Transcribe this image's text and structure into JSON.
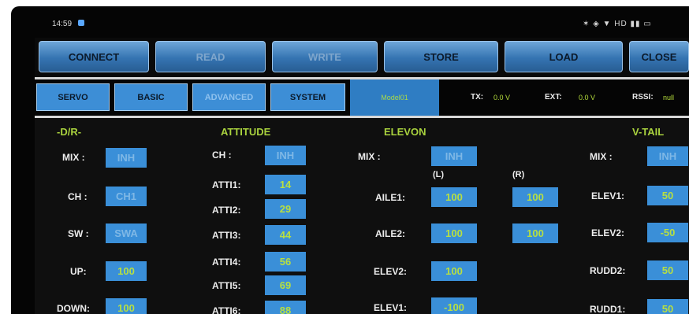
{
  "status": {
    "time": "14:59",
    "icons_right": "✶ ◈ ▼ HD ▮▮ ▭"
  },
  "toolbar": {
    "connect": "CONNECT",
    "read": "READ",
    "write": "WRITE",
    "store": "STORE",
    "load": "LOAD",
    "close": "CLOSE"
  },
  "tabs": {
    "servo": "SERVO",
    "basic": "BASIC",
    "advanced": "ADVANCED",
    "system": "SYSTEM",
    "model": "Model01"
  },
  "telemetry": {
    "tx_label": "TX:",
    "tx_value": "0.0 V",
    "ext_label": "EXT:",
    "ext_value": "0.0 V",
    "rssi_label": "RSSI:",
    "rssi_value": "null"
  },
  "dr": {
    "title": "-D/R-",
    "mix_label": "MIX :",
    "mix_value": "INH",
    "ch_label": "CH :",
    "ch_value": "CH1",
    "sw_label": "SW :",
    "sw_value": "SWA",
    "up_label": "UP:",
    "up_value": "100",
    "down_label": "DOWN:",
    "down_value": "100"
  },
  "attitude": {
    "title": "ATTITUDE",
    "ch_label": "CH :",
    "ch_value": "INH",
    "att1_label": "ATTI1:",
    "att1_value": "14",
    "att2_label": "ATTI2:",
    "att2_value": "29",
    "att3_label": "ATTI3:",
    "att3_value": "44",
    "att4_label": "ATTI4:",
    "att4_value": "56",
    "att5_label": "ATTI5:",
    "att5_value": "69",
    "att6_label": "ATTI6:",
    "att6_value": "88"
  },
  "elevon": {
    "title": "ELEVON",
    "mix_label": "MIX :",
    "mix_value": "INH",
    "l_label": "(L)",
    "r_label": "(R)",
    "aile1_label": "AILE1:",
    "aile1_l": "100",
    "aile1_r": "100",
    "aile2_label": "AILE2:",
    "aile2_l": "100",
    "aile2_r": "100",
    "elev2_label": "ELEV2:",
    "elev2_value": "100",
    "elev1_label": "ELEV1:",
    "elev1_value": "-100"
  },
  "vtail": {
    "title": "V-TAIL",
    "mix_label": "MIX :",
    "mix_value": "INH",
    "elev1_label": "ELEV1:",
    "elev1_value": "50",
    "elev2_label": "ELEV2:",
    "elev2_value": "-50",
    "rudd2_label": "RUDD2:",
    "rudd2_value": "50",
    "rudd1_label": "RUDD1:",
    "rudd1_value": "50"
  }
}
